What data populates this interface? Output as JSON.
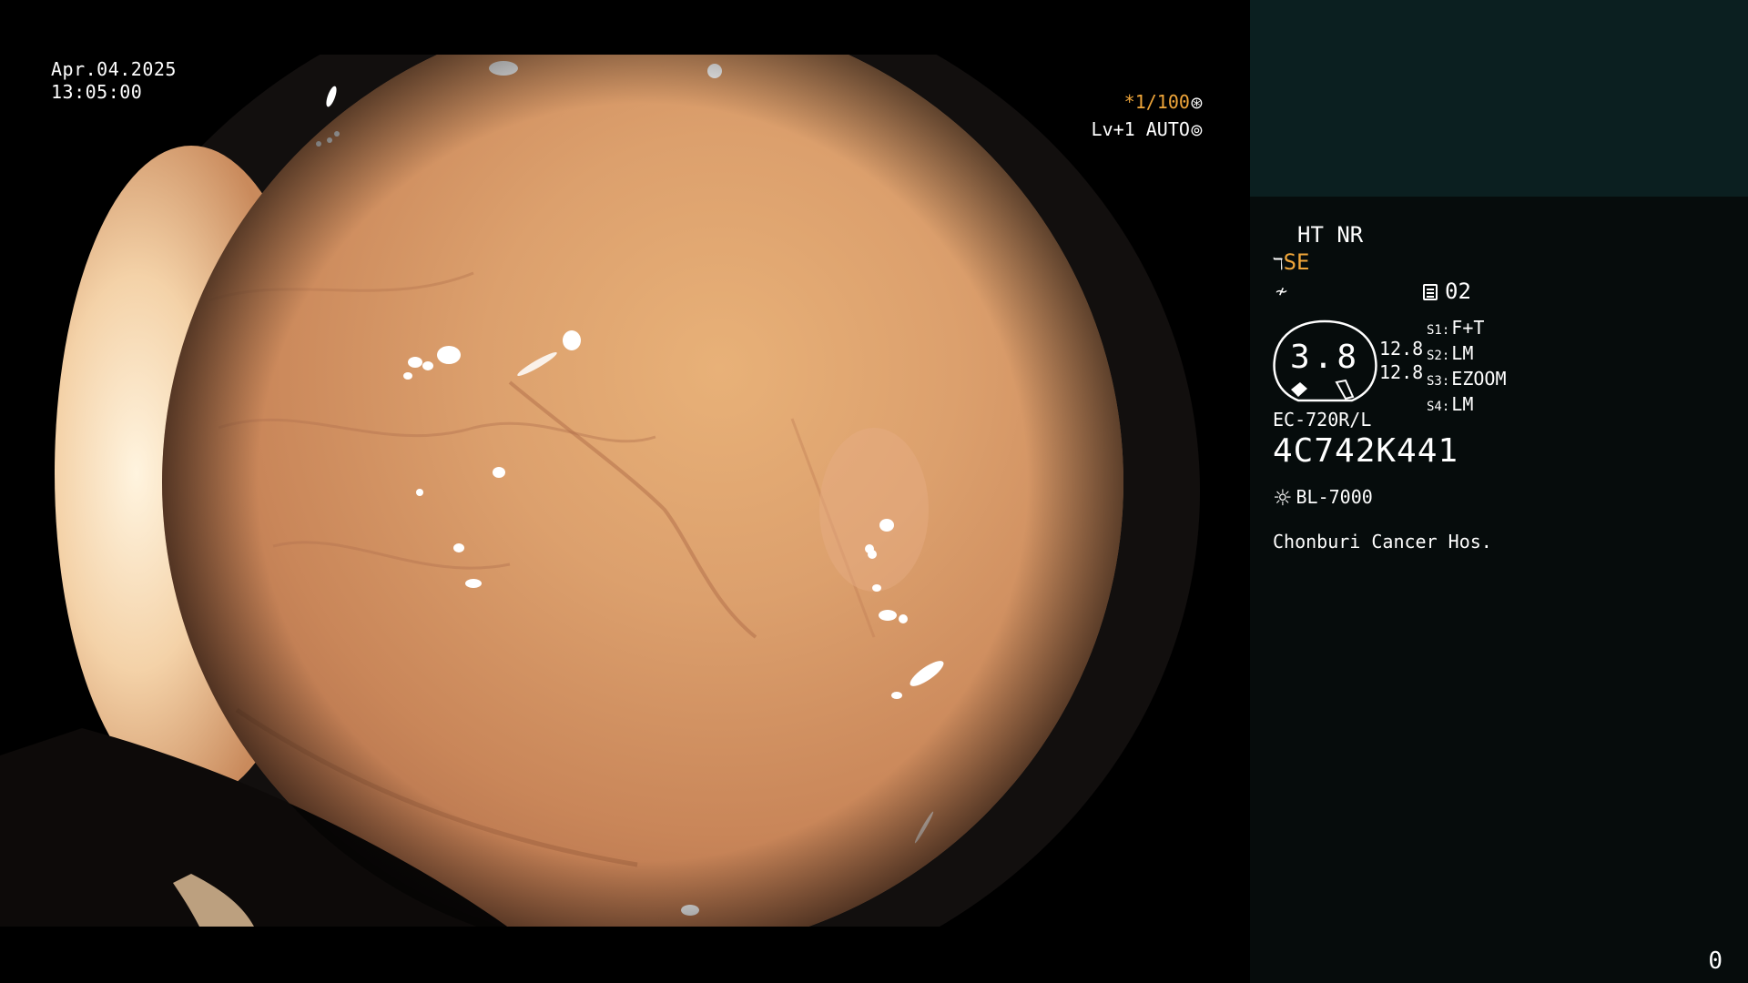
{
  "overlay": {
    "date": "Apr.04.2025",
    "time": "13:05:00",
    "shutter": "*1/100",
    "level": "Lv+1 AUTO",
    "shutter_icon": "aperture-icon",
    "level_icon": "auto-iris-icon"
  },
  "panel": {
    "ht_nr": "HT NR",
    "structure_enhance": "SE",
    "memory_index": "02",
    "zoom_value": "3.8",
    "zoom_levels": [
      "12.8",
      "12.8"
    ],
    "switches": [
      {
        "key": "S1:",
        "value": "F+T"
      },
      {
        "key": "S2:",
        "value": "LM"
      },
      {
        "key": "S3:",
        "value": "EZOOM"
      },
      {
        "key": "S4:",
        "value": "LM"
      }
    ],
    "scope_model": "EC-720R/L",
    "scope_serial": "4C742K441",
    "light_source": "BL-7000",
    "hospital": "Chonburi Cancer Hos.",
    "counter": "0"
  },
  "colors": {
    "accent": "#f0a63a",
    "panel_bg": "#060c0c",
    "thumb_bg": "#0b1f20",
    "tissue": "#d99a6c"
  }
}
